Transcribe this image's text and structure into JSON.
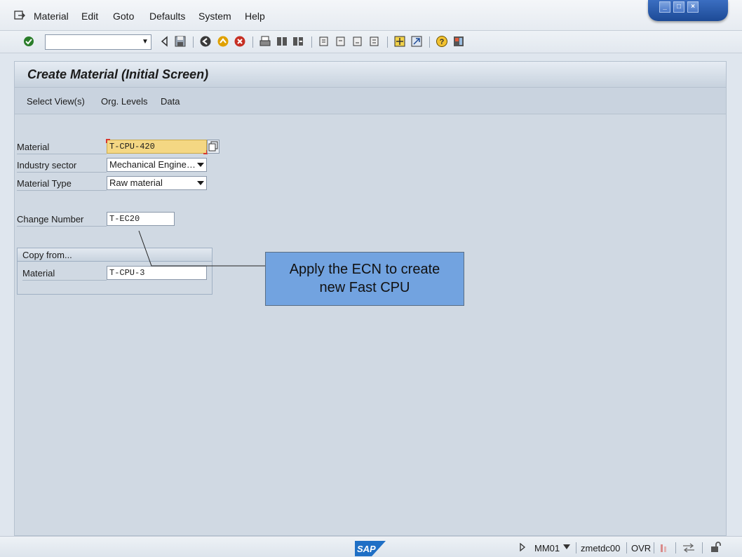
{
  "menu": {
    "items": [
      "Material",
      "Edit",
      "Goto",
      "Defaults",
      "System",
      "Help"
    ]
  },
  "toolbar": {
    "command_value": ""
  },
  "screen": {
    "title": "Create Material (Initial Screen)",
    "app_buttons": [
      "Select View(s)",
      "Org. Levels",
      "Data"
    ]
  },
  "form": {
    "material_label": "Material",
    "material_value": "T-CPU-420",
    "industry_label": "Industry sector",
    "industry_value": "Mechanical Enginee…",
    "type_label": "Material Type",
    "type_value": "Raw material",
    "change_label": "Change Number",
    "change_value": "T-EC20"
  },
  "copy_from": {
    "title": "Copy from...",
    "material_label": "Material",
    "material_value": "T-CPU-3"
  },
  "callout": {
    "line1": "Apply the ECN to create",
    "line2": "new Fast CPU"
  },
  "status": {
    "logo": "SAP",
    "transaction": "MM01",
    "server": "zmetdc00",
    "mode": "OVR"
  },
  "colors": {
    "background": "#dfe6ee",
    "callout": "#72a3e0",
    "required_field": "#f4d783"
  }
}
